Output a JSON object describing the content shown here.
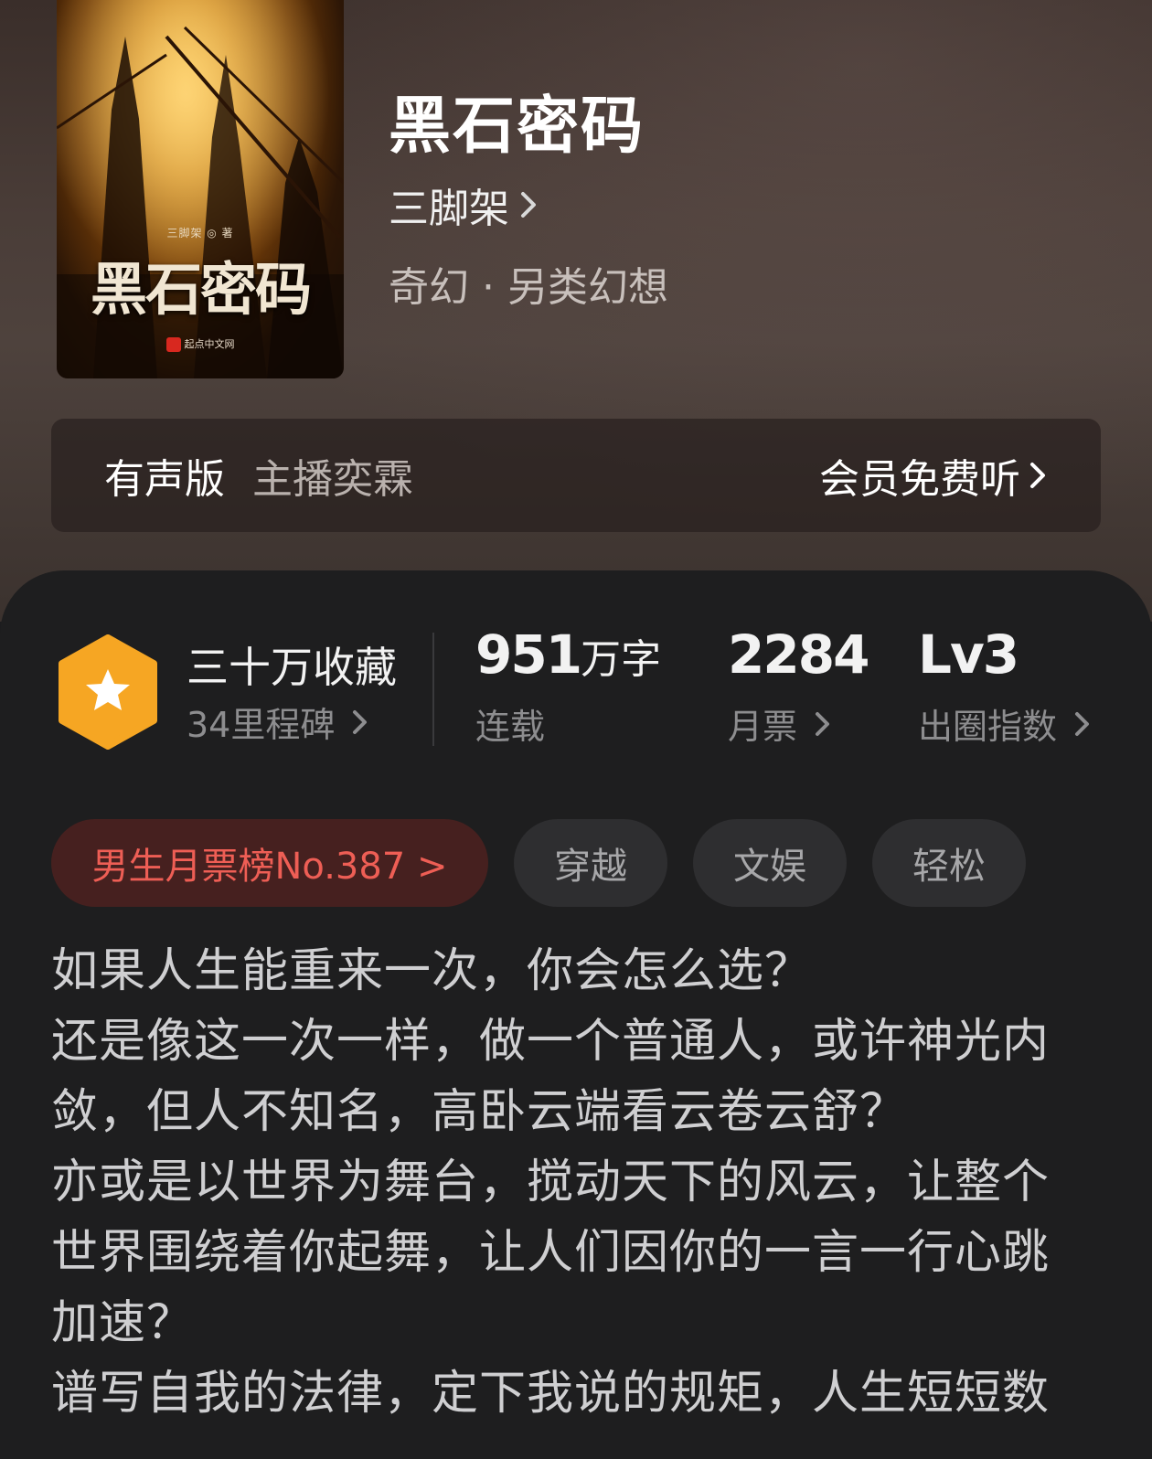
{
  "book": {
    "title": "黑石密码",
    "author": "三脚架",
    "genre": "奇幻 · 另类幻想",
    "cover": {
      "title": "黑石密码",
      "author_line": "三脚架 ◎ 著",
      "publisher": "起点中文网"
    }
  },
  "audio": {
    "label": "有声版",
    "host": "主播奕霖",
    "cta": "会员免费听"
  },
  "stats": {
    "collection": {
      "title": "三十万收藏",
      "sub": "34里程碑"
    },
    "words": {
      "value": "951",
      "unit": "万字",
      "label": "连载"
    },
    "tickets": {
      "value": "2284",
      "label": "月票"
    },
    "influence": {
      "value": "Lv3",
      "label": "出圈指数"
    }
  },
  "tags": [
    {
      "label": "男生月票榜No.387 >"
    },
    {
      "label": "穿越"
    },
    {
      "label": "文娱"
    },
    {
      "label": "轻松"
    }
  ],
  "synopsis": {
    "lines": [
      "如果人生能重来一次，你会怎么选？",
      "还是像这一次一样，做一个普通人，或许神光内",
      "敛，但人不知名，高卧云端看云卷云舒？",
      "亦或是以世界为舞台，搅动天下的风云，让整个",
      "世界围绕着你起舞，让人们因你的一言一行心跳",
      "加速？",
      "谱写自我的法律，定下我说的规矩，人生短短数"
    ]
  },
  "colors": {
    "accent_red": "#ee5e55",
    "badge_orange": "#f5a623"
  }
}
